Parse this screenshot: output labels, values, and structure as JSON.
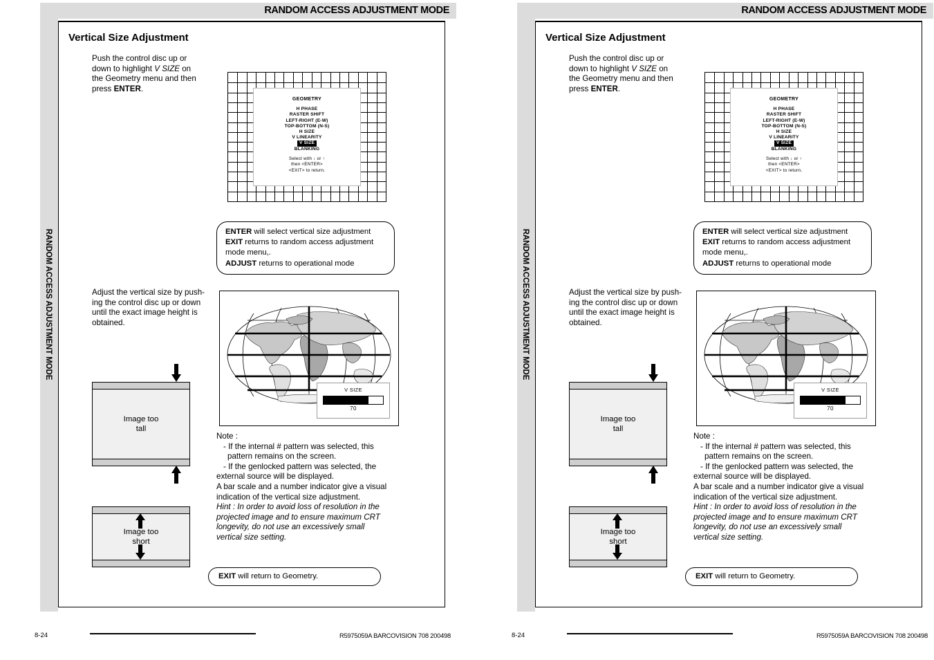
{
  "header": {
    "title": "RANDOM ACCESS ADJUSTMENT MODE"
  },
  "spine": {
    "text": "RANDOM ACCESS ADJUSTMENT MODE"
  },
  "section": {
    "title": "Vertical Size Adjustment"
  },
  "intro": {
    "line1": "Push the control disc up or",
    "line2_a": "down to highlight ",
    "line2_em": "V SIZE",
    "line2_b": " on",
    "line3": "the Geometry menu and then",
    "line4_a": "press ",
    "line4_b": "ENTER",
    "line4_c": "."
  },
  "osd_menu": {
    "title": "GEOMETRY",
    "items": [
      "H  PHASE",
      "RASTER  SHIFT",
      "LEFT-RIGHT  (E-W)",
      "TOP-BOTTOM  (N-S)",
      "H  SIZE",
      "V  LINEARITY",
      "V  SIZE",
      "BLANKING"
    ],
    "selected_index": 6,
    "hint_line1_a": "Select with ",
    "hint_line1_down": "↓",
    "hint_line1_b": " or ",
    "hint_line1_up": "↑",
    "hint_line2": "then  <ENTER>",
    "hint_line3": "<EXIT>  to  return."
  },
  "key_callout": {
    "l1_b": "ENTER",
    "l1_t": " will select vertical size adjustment",
    "l2_b": "EXIT",
    "l2_t": " returns to random access adjustment",
    "l3_t": "mode menu,.",
    "l4_b": "ADJUST",
    "l4_t": " returns to operational mode"
  },
  "adjust_para": {
    "line1": "Adjust the vertical size by push-",
    "line2": "ing the control disc up or down",
    "line3": "until the exact image height is",
    "line4": "obtained."
  },
  "vsize_osd": {
    "label": "V  SIZE",
    "value": "70",
    "fill_percent": 75
  },
  "image_boxes": [
    {
      "name": "image-too-tall",
      "caption_line1": "Image too",
      "caption_line2": "tall",
      "arrows": "outside"
    },
    {
      "name": "image-too-short",
      "caption_line1": "Image too",
      "caption_line2": "short",
      "arrows": "inside"
    }
  ],
  "note": {
    "title": "Note  :",
    "b1_l1": "- If the internal # pattern was selected, this",
    "b1_l2": "pattern remains on the screen.",
    "b2_l1": "- If the genlocked pattern was selected, the",
    "b2_l2": "external source will be displayed.",
    "p_l1": "A bar scale and a number indicator give a visual",
    "p_l2": "indication of the vertical size adjustment.",
    "hint_l1": "Hint : In order to avoid loss of resolution in the",
    "hint_l2": "projected image and to ensure maximum CRT",
    "hint_l3": "longevity, do not use an excessively small",
    "hint_l4": "vertical  size  setting."
  },
  "exit_callout": {
    "bold": "EXIT",
    "text": " will return to Geometry."
  },
  "footer": {
    "page_number": "8-24",
    "reference": "R5975059A BARCOVISION 708 200498"
  },
  "colors": {
    "band": "#dcdcdc",
    "image_fill": "#f0f0f0",
    "image_band": "#cfcfcf"
  }
}
